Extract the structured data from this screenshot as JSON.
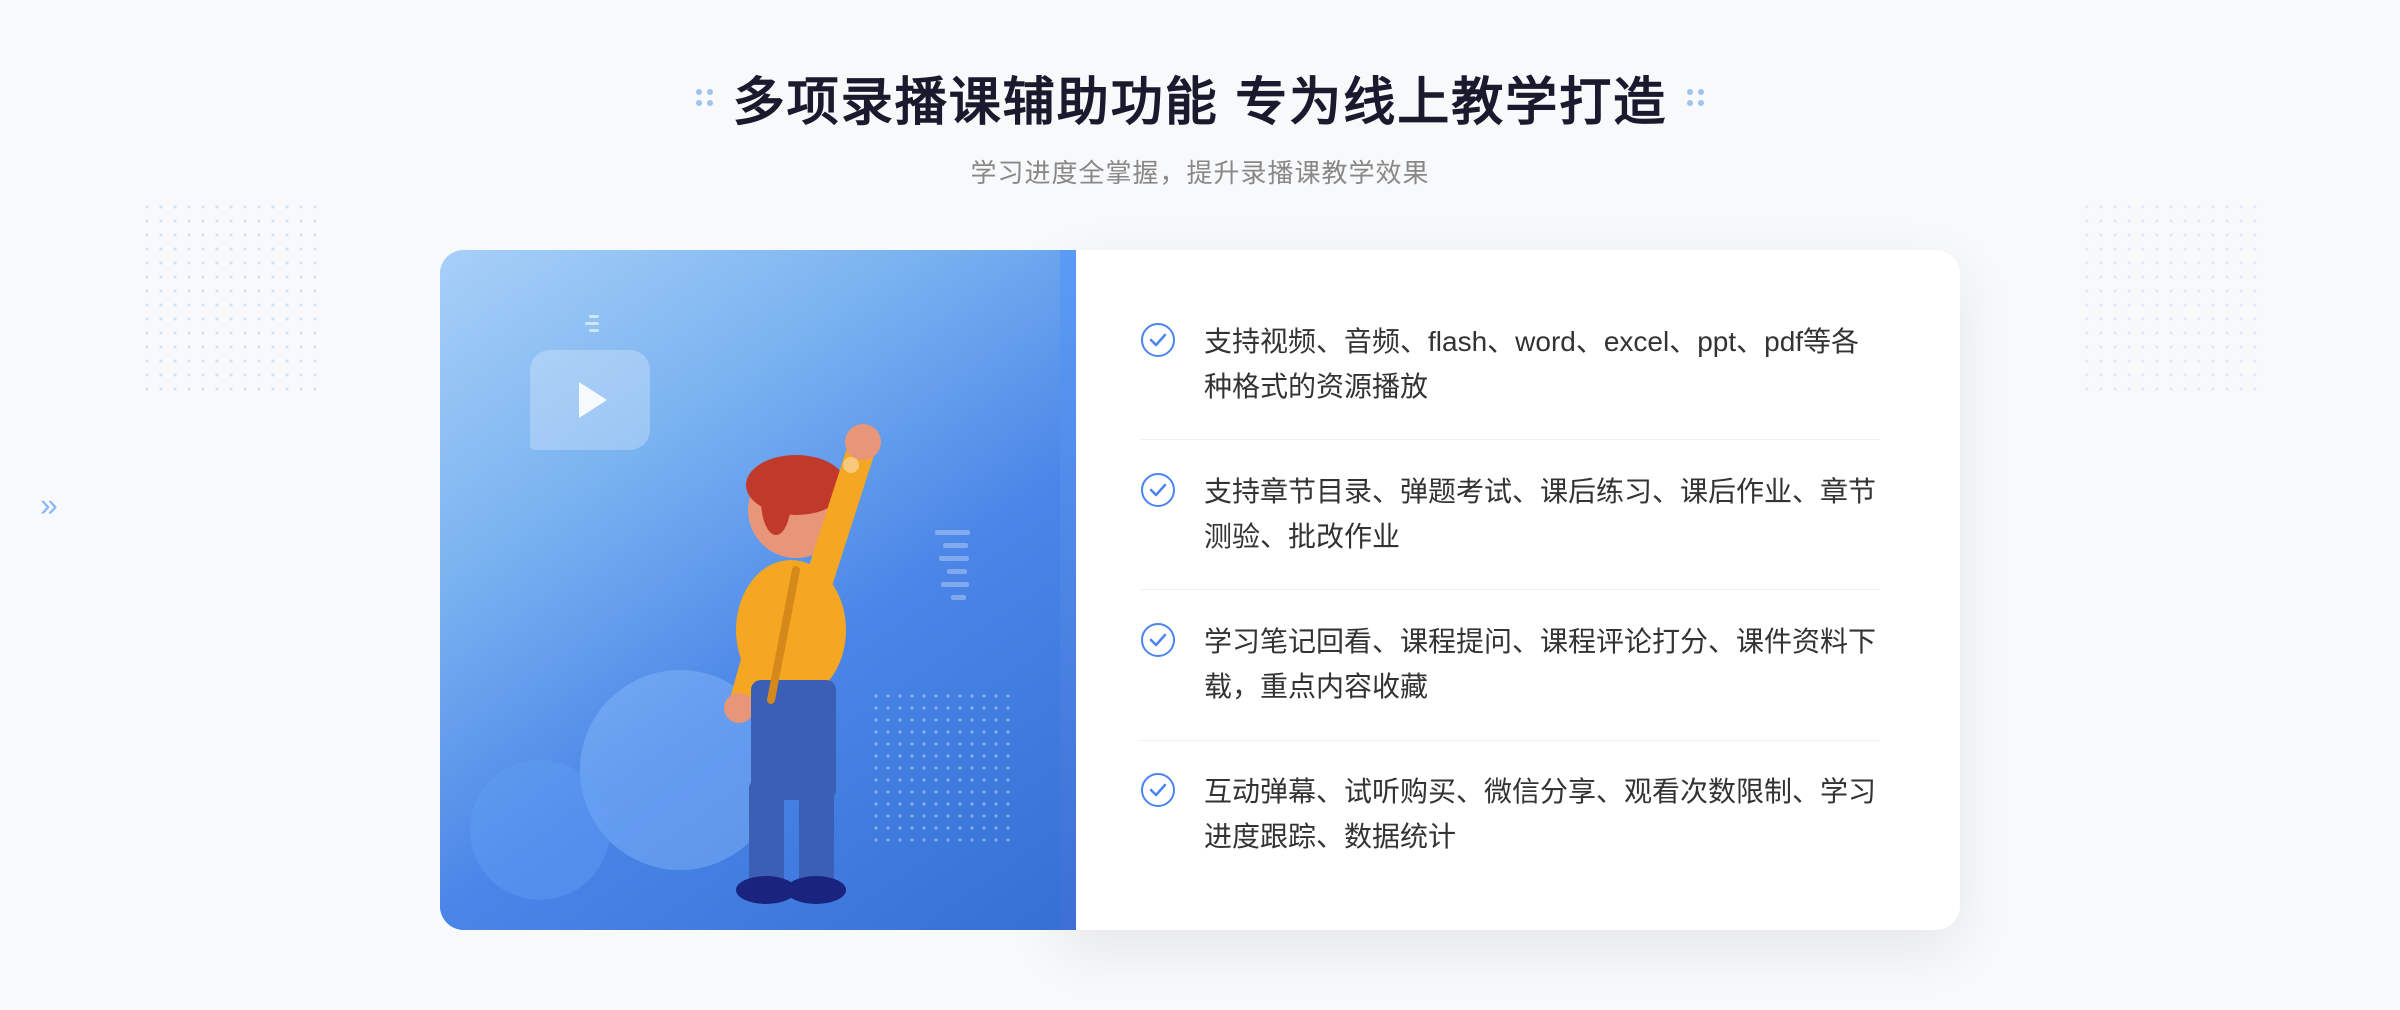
{
  "header": {
    "title": "多项录播课辅助功能 专为线上教学打造",
    "subtitle": "学习进度全掌握，提升录播课教学效果",
    "deco_dots_count": 4
  },
  "features": [
    {
      "id": 1,
      "text": "支持视频、音频、flash、word、excel、ppt、pdf等各种格式的资源播放"
    },
    {
      "id": 2,
      "text": "支持章节目录、弹题考试、课后练习、课后作业、章节测验、批改作业"
    },
    {
      "id": 3,
      "text": "学习笔记回看、课程提问、课程评论打分、课件资料下载，重点内容收藏"
    },
    {
      "id": 4,
      "text": "互动弹幕、试听购买、微信分享、观看次数限制、学习进度跟踪、数据统计"
    }
  ],
  "colors": {
    "primary_blue": "#4a85f0",
    "light_blue": "#7ab3f5",
    "check_color": "#4a85f0",
    "title_color": "#1a1a2e",
    "text_color": "#333333",
    "subtitle_color": "#888888"
  },
  "decorations": {
    "left_arrow": "»"
  }
}
